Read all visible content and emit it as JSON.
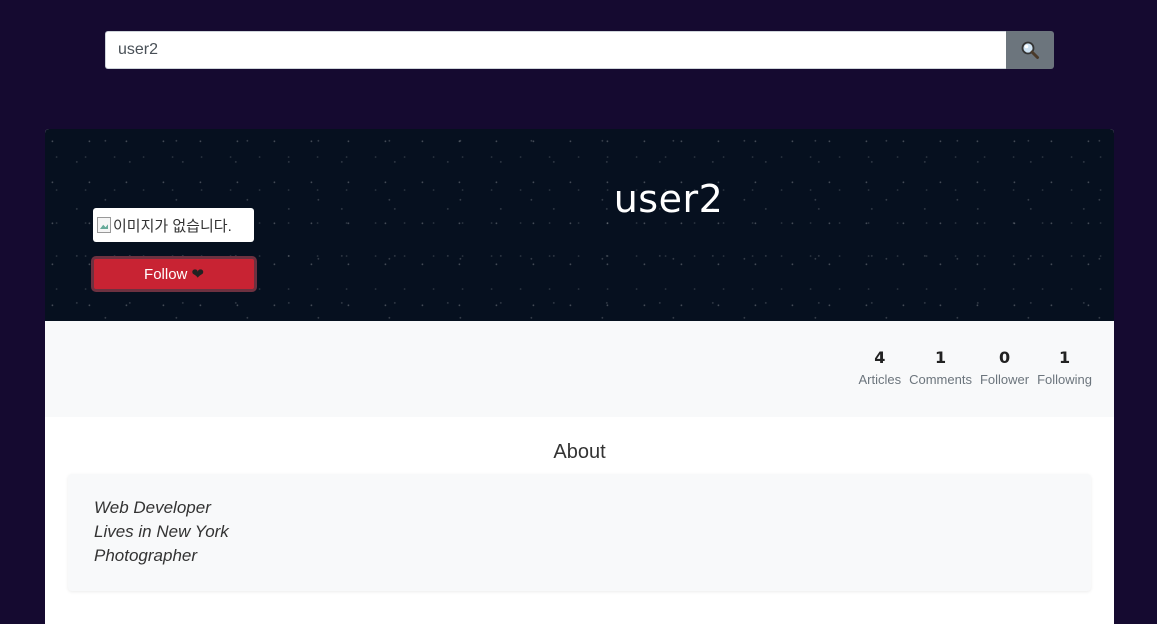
{
  "search": {
    "value": "user2",
    "button_icon": "search-icon"
  },
  "profile": {
    "username": "user2",
    "avatar_alt": "이미지가 없습니다.",
    "follow_label": "Follow",
    "follow_icon": "heart-icon"
  },
  "stats": [
    {
      "value": "4",
      "label": "Articles"
    },
    {
      "value": "1",
      "label": "Comments"
    },
    {
      "value": "0",
      "label": "Follower"
    },
    {
      "value": "1",
      "label": "Following"
    }
  ],
  "about": {
    "title": "About",
    "lines": [
      "Web Developer",
      "Lives in New York",
      "Photographer"
    ]
  },
  "colors": {
    "page_bg": "#150a30",
    "banner_bg": "#06101f",
    "follow_button": "#c82333",
    "search_button": "#6c757d"
  }
}
